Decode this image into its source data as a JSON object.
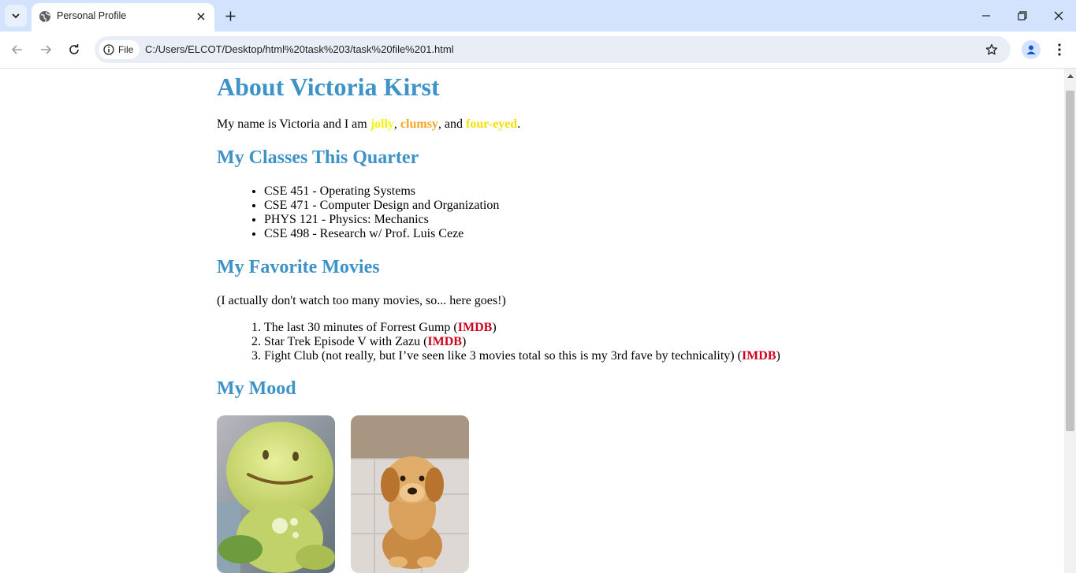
{
  "browser": {
    "tab_title": "Personal Profile",
    "site_chip_label": "File",
    "url": "C:/Users/ELCOT/Desktop/html%20task%203/task%20file%201.html"
  },
  "page": {
    "title": "About Victoria Kirst",
    "intro": {
      "prefix": "My name is Victoria and I am ",
      "adj1": "jolly",
      "sep1": ", ",
      "adj2": "clumsy",
      "sep2": ", and ",
      "adj3": "four-eyed",
      "suffix": "."
    },
    "classes_heading": "My Classes This Quarter",
    "classes": [
      "CSE 451 - Operating Systems",
      "CSE 471 - Computer Design and Organization",
      "PHYS 121 - Physics: Mechanics",
      "CSE 498 - Research w/ Prof. Luis Ceze"
    ],
    "movies_heading": "My Favorite Movies",
    "movies_note": "(I actually don't watch too many movies, so... here goes!)",
    "movies": [
      {
        "text": "The last 30 minutes of Forrest Gump (",
        "link": "IMDB",
        "close": ")"
      },
      {
        "text": "Star Trek Episode V with Zazu (",
        "link": "IMDB",
        "close": ")"
      },
      {
        "text": "Fight Club (not really, but I’ve seen like 3 movies total so this is my 3rd fave by technicality) (",
        "link": "IMDB",
        "close": ")"
      }
    ],
    "mood_heading": "My Mood",
    "mood_images": [
      {
        "name": "smiley-toy-image"
      },
      {
        "name": "puppy-image"
      }
    ]
  },
  "colors": {
    "heading": "#3d92c8",
    "jolly": "#f5f500",
    "clumsy": "#f5a623",
    "four_eyed": "#f5e000",
    "imdb_link": "#d0021b",
    "tabbar": "#d3e3fd"
  }
}
